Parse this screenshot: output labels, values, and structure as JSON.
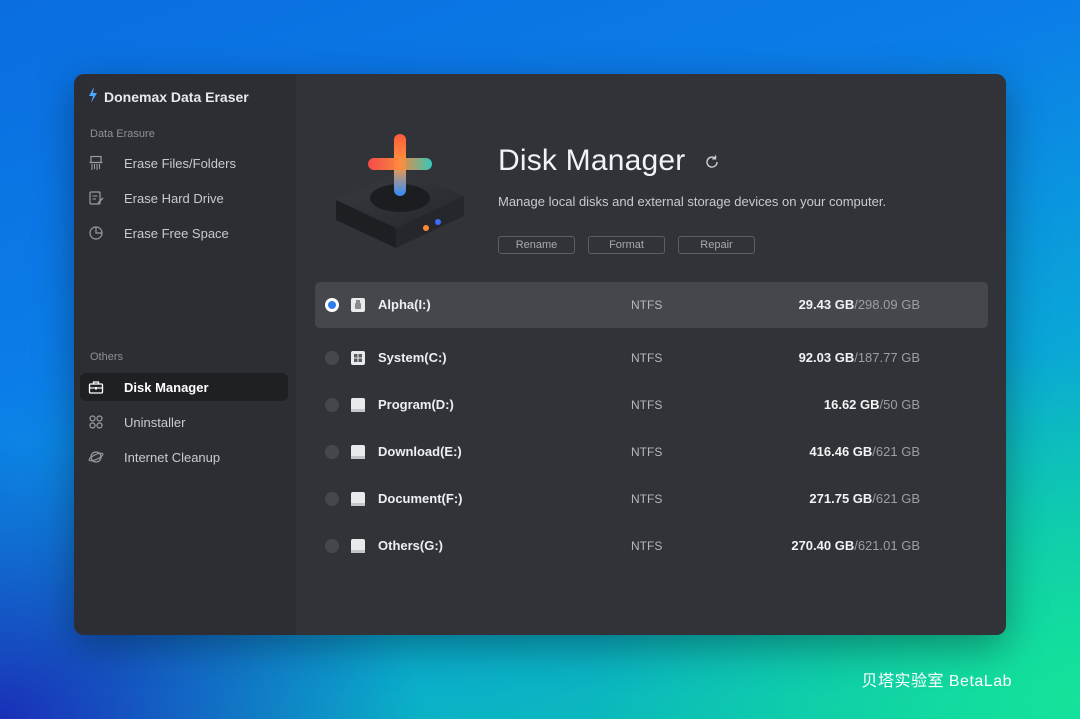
{
  "app": {
    "title": "Donemax Data Eraser"
  },
  "window_controls": [
    {
      "name": "history-icon"
    },
    {
      "name": "menu-icon"
    },
    {
      "name": "minimize-icon"
    },
    {
      "name": "maximize-icon"
    },
    {
      "name": "close-icon"
    }
  ],
  "sidebar": {
    "sections": [
      {
        "label": "Data Erasure",
        "items": [
          {
            "label": "Erase Files/Folders",
            "icon": "shredder-icon"
          },
          {
            "label": "Erase Hard Drive",
            "icon": "hard-drive-erase-icon"
          },
          {
            "label": "Erase Free Space",
            "icon": "pie-chart-icon"
          }
        ]
      },
      {
        "label": "Others",
        "items": [
          {
            "label": "Disk Manager",
            "icon": "toolbox-icon",
            "active": true
          },
          {
            "label": "Uninstaller",
            "icon": "apps-grid-icon"
          },
          {
            "label": "Internet Cleanup",
            "icon": "planet-icon"
          }
        ]
      }
    ]
  },
  "main": {
    "title": "Disk Manager",
    "subtitle": "Manage local disks and external storage devices on your computer.",
    "actions": [
      "Rename",
      "Format",
      "Repair"
    ],
    "disks": [
      {
        "name": "Alpha(I:)",
        "fs": "NTFS",
        "used": "29.43 GB",
        "total": "/298.09 GB",
        "selected": true,
        "icon": "usb-drive-icon"
      },
      {
        "name": "System(C:)",
        "fs": "NTFS",
        "used": "92.03 GB",
        "total": "/187.77 GB",
        "icon": "windows-drive-icon"
      },
      {
        "name": "Program(D:)",
        "fs": "NTFS",
        "used": "16.62 GB",
        "total": "/50 GB",
        "icon": "drive-icon"
      },
      {
        "name": "Download(E:)",
        "fs": "NTFS",
        "used": "416.46 GB",
        "total": "/621 GB",
        "icon": "drive-icon"
      },
      {
        "name": "Document(F:)",
        "fs": "NTFS",
        "used": "271.75 GB",
        "total": "/621 GB",
        "icon": "drive-icon"
      },
      {
        "name": "Others(G:)",
        "fs": "NTFS",
        "used": "270.40 GB",
        "total": "/621.01 GB",
        "icon": "drive-icon"
      }
    ]
  },
  "colors": {
    "accent": "#2d7df0",
    "window_bg": "#2d2e33",
    "main_bg": "#323338",
    "selected_row": "#46474d"
  },
  "watermark": "贝塔实验室 BetaLab"
}
